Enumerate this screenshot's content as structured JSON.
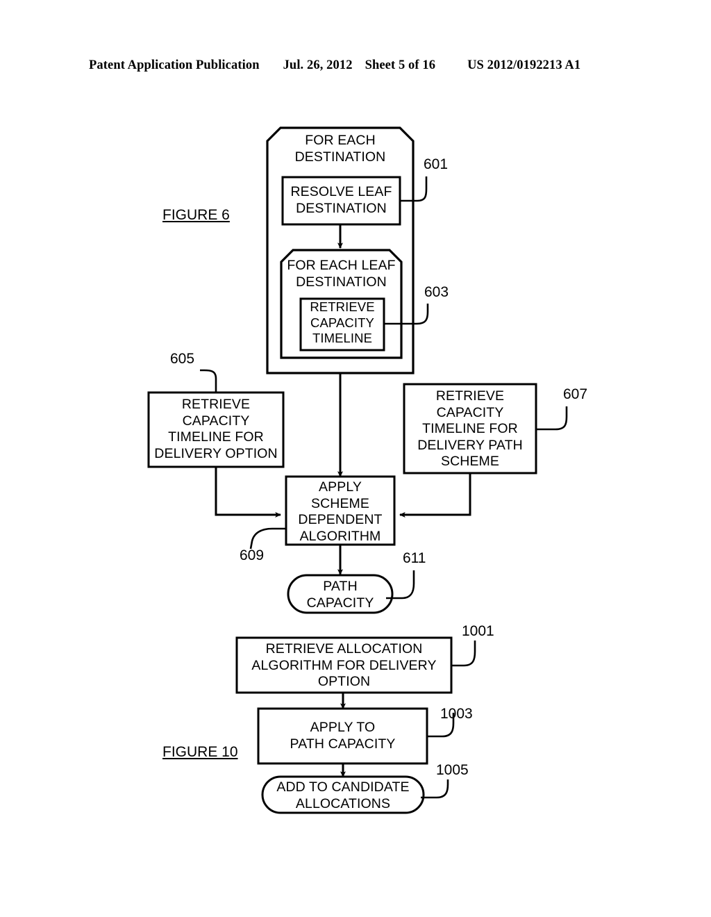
{
  "header": {
    "publication": "Patent Application Publication",
    "date": "Jul. 26, 2012",
    "sheet": "Sheet 5 of 16",
    "patent_number": "US 2012/0192213 A1"
  },
  "figures": [
    {
      "id": "figure-6",
      "label": "FIGURE 6"
    },
    {
      "id": "figure-10",
      "label": "FIGURE 10"
    }
  ],
  "figure6": {
    "label": "FIGURE 6",
    "nodes": {
      "outer_loop": {
        "text": "FOR EACH\nDESTINATION",
        "shape": "loop-container"
      },
      "resolve_leaf": {
        "text": "RESOLVE LEAF\nDESTINATION",
        "shape": "process"
      },
      "inner_loop": {
        "text": "FOR EACH LEAF\nDESTINATION",
        "shape": "loop-container"
      },
      "retrieve_cap": {
        "text": "RETRIEVE\nCAPACITY\nTIMELINE",
        "shape": "process"
      },
      "retrieve_opt": {
        "text": "RETRIEVE\nCAPACITY\nTIMELINE FOR\nDELIVERY OPTION",
        "shape": "process"
      },
      "retrieve_path": {
        "text": "RETRIEVE\nCAPACITY\nTIMELINE FOR\nDELIVERY PATH\nSCHEME",
        "shape": "process"
      },
      "apply_scheme": {
        "text": "APPLY\nSCHEME\nDEPENDENT\nALGORITHM",
        "shape": "process"
      },
      "path_capacity": {
        "text": "PATH\nCAPACITY",
        "shape": "terminator"
      }
    },
    "reference_numerals": {
      "outer_loop": "601",
      "inner_retrieve": "603",
      "retrieve_opt": "605",
      "retrieve_path": "607",
      "apply_scheme": "609",
      "path_capacity": "611"
    }
  },
  "figure10": {
    "label": "FIGURE 10",
    "nodes": {
      "retrieve_alloc": {
        "text": "RETRIEVE ALLOCATION\nALGORITHM FOR DELIVERY\nOPTION",
        "shape": "process"
      },
      "apply_to_path": {
        "text": "APPLY TO\nPATH CAPACITY",
        "shape": "process"
      },
      "add_candidate": {
        "text": "ADD TO CANDIDATE\nALLOCATIONS",
        "shape": "terminator"
      }
    },
    "reference_numerals": {
      "retrieve_alloc": "1001",
      "apply_to_path": "1003",
      "add_candidate": "1005"
    }
  },
  "style": {
    "line_color": "#000000",
    "fill_color": "#ffffff",
    "page_background": "#ffffff"
  }
}
